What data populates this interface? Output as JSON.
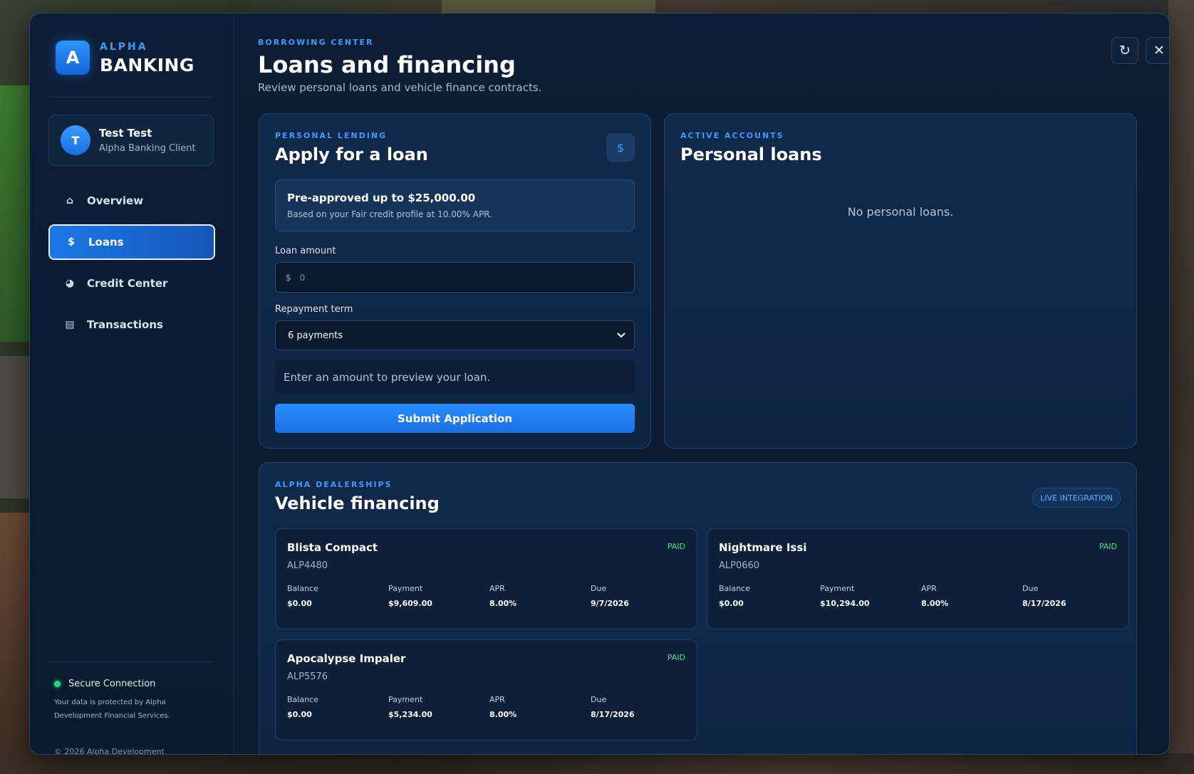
{
  "brand": {
    "small": "ALPHA",
    "big": "BANKING",
    "logo_letter": "A"
  },
  "user": {
    "initial": "T",
    "name": "Test Test",
    "subtitle": "Alpha Banking Client"
  },
  "nav": [
    {
      "label": "Overview",
      "icon": "home-icon",
      "active": false
    },
    {
      "label": "Loans",
      "icon": "dollar-icon",
      "active": true
    },
    {
      "label": "Credit Center",
      "icon": "pie-chart-icon",
      "active": false
    },
    {
      "label": "Transactions",
      "icon": "list-icon",
      "active": false
    }
  ],
  "security": {
    "status": "Secure Connection",
    "description": "Your data is protected by Alpha Development Financial Services.",
    "copyright": "© 2026 Alpha Development"
  },
  "header": {
    "eyebrow": "BORROWING CENTER",
    "title": "Loans and financing",
    "subtitle": "Review personal loans and vehicle finance contracts."
  },
  "actions": {
    "refresh_icon": "refresh-icon",
    "close_icon": "close-icon"
  },
  "apply": {
    "eyebrow": "PERSONAL LENDING",
    "title": "Apply for a loan",
    "chip_icon": "$",
    "preapproval_title": "Pre-approved up to $25,000.00",
    "preapproval_sub": "Based on your Fair credit profile at 10.00% APR.",
    "amount_label": "Loan amount",
    "amount_prefix": "$",
    "amount_value": "",
    "amount_placeholder": "0",
    "term_label": "Repayment term",
    "term_selected": "6 payments",
    "preview_text": "Enter an amount to preview your loan.",
    "submit_label": "Submit Application"
  },
  "personal_loans": {
    "eyebrow": "ACTIVE ACCOUNTS",
    "title": "Personal loans",
    "empty_text": "No personal loans."
  },
  "vehicle": {
    "eyebrow": "ALPHA DEALERSHIPS",
    "title": "Vehicle financing",
    "badge": "LIVE INTEGRATION",
    "stat_labels": {
      "balance": "Balance",
      "payment": "Payment",
      "apr": "APR",
      "due": "Due"
    },
    "contracts": [
      {
        "name": "Blista Compact",
        "plate": "ALP4480",
        "status": "PAID",
        "balance": "$0.00",
        "payment": "$9,609.00",
        "apr": "8.00%",
        "due": "9/7/2026"
      },
      {
        "name": "Nightmare Issi",
        "plate": "ALP0660",
        "status": "PAID",
        "balance": "$0.00",
        "payment": "$10,294.00",
        "apr": "8.00%",
        "due": "8/17/2026"
      },
      {
        "name": "Apocalypse Impaler",
        "plate": "ALP5576",
        "status": "PAID",
        "balance": "$0.00",
        "payment": "$5,234.00",
        "apr": "8.00%",
        "due": "8/17/2026"
      }
    ]
  },
  "colors": {
    "accent": "#2a8eff",
    "paid": "#3ee08a",
    "secure": "#2ed47a",
    "panel": "#0d1d33"
  }
}
